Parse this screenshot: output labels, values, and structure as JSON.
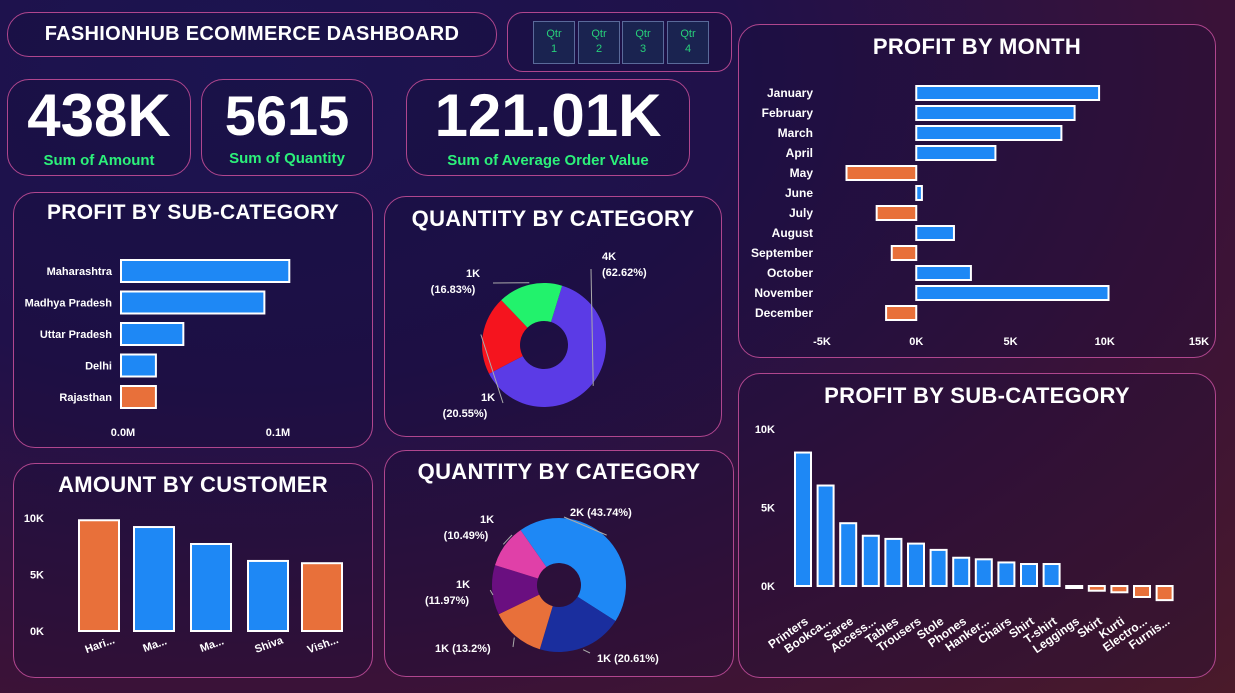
{
  "header": {
    "title": "FASHIONHUB ECOMMERCE DASHBOARD"
  },
  "quarter_slicer": {
    "buttons": [
      {
        "line1": "Qtr",
        "line2": "1"
      },
      {
        "line1": "Qtr",
        "line2": "2"
      },
      {
        "line1": "Qtr",
        "line2": "3"
      },
      {
        "line1": "Qtr",
        "line2": "4"
      }
    ]
  },
  "kpis": [
    {
      "value": "438K",
      "label": "Sum of Amount"
    },
    {
      "value": "5615",
      "label": "Sum of Quantity"
    },
    {
      "value": "121.01K",
      "label": "Sum of Average Order Value"
    }
  ],
  "colors": {
    "positive": "#1e88f5",
    "negative": "#e8703a",
    "green_label": "#2cf07a"
  },
  "chart_data": [
    {
      "id": "profit_by_state",
      "type": "bar",
      "orientation": "horizontal",
      "title": "PROFIT BY SUB-CATEGORY",
      "categories": [
        "Maharashtra",
        "Madhya Pradesh",
        "Uttar Pradesh",
        "Delhi",
        "Rajasthan"
      ],
      "values": [
        0.135,
        0.115,
        0.05,
        0.028,
        0.028
      ],
      "bar_colors": [
        "#1e88f5",
        "#1e88f5",
        "#1e88f5",
        "#1e88f5",
        "#e8703a"
      ],
      "ticks": [
        {
          "v": 0,
          "label": "0.0M"
        },
        {
          "v": 0.1,
          "label": "0.1M"
        }
      ],
      "xlim": [
        0,
        0.15
      ]
    },
    {
      "id": "quantity_by_category_1",
      "type": "pie",
      "donut": true,
      "title": "QUANTITY BY CATEGORY",
      "slices": [
        {
          "value": 62.62,
          "color": "#5b3be6",
          "label_top": "4K",
          "label_bottom": "(62.62%)"
        },
        {
          "value": 20.55,
          "color": "#f5141e",
          "label_top": "1K",
          "label_bottom": "(20.55%)"
        },
        {
          "value": 16.83,
          "color": "#22f26c",
          "label_top": "1K",
          "label_bottom": "(16.83%)"
        }
      ]
    },
    {
      "id": "quantity_by_category_2",
      "type": "pie",
      "donut": true,
      "title": "QUANTITY BY CATEGORY",
      "slices": [
        {
          "value": 43.74,
          "color": "#1e88f5",
          "label_top": "2K (43.74%)",
          "label_bottom": ""
        },
        {
          "value": 20.61,
          "color": "#1a2e9e",
          "label_top": "1K (20.61%)",
          "label_bottom": ""
        },
        {
          "value": 13.2,
          "color": "#e8703a",
          "label_top": "1K (13.2%)",
          "label_bottom": ""
        },
        {
          "value": 11.97,
          "color": "#6a0f80",
          "label_top": "1K",
          "label_bottom": "(11.97%)"
        },
        {
          "value": 10.49,
          "color": "#e040a8",
          "label_top": "1K",
          "label_bottom": "(10.49%)"
        }
      ]
    },
    {
      "id": "amount_by_customer",
      "type": "bar",
      "title": "AMOUNT BY CUSTOMER",
      "categories": [
        "Hari...",
        "Ma...",
        "Ma...",
        "Shiva",
        "Vish..."
      ],
      "values": [
        9800,
        9200,
        7700,
        6200,
        6000
      ],
      "bar_colors": [
        "#e8703a",
        "#1e88f5",
        "#1e88f5",
        "#1e88f5",
        "#e8703a"
      ],
      "ticks": [
        {
          "v": 0,
          "label": "0K"
        },
        {
          "v": 5000,
          "label": "5K"
        },
        {
          "v": 10000,
          "label": "10K"
        }
      ],
      "ylim": [
        0,
        10000
      ]
    },
    {
      "id": "profit_by_month",
      "type": "bar",
      "orientation": "horizontal",
      "title": "PROFIT BY MONTH",
      "categories": [
        "January",
        "February",
        "March",
        "April",
        "May",
        "June",
        "July",
        "August",
        "September",
        "October",
        "November",
        "December"
      ],
      "values": [
        9700,
        8400,
        7700,
        4200,
        -3700,
        300,
        -2100,
        2000,
        -1300,
        2900,
        10200,
        -1600
      ],
      "ticks": [
        {
          "v": -5000,
          "label": "-5K"
        },
        {
          "v": 0,
          "label": "0K"
        },
        {
          "v": 5000,
          "label": "5K"
        },
        {
          "v": 10000,
          "label": "10K"
        },
        {
          "v": 15000,
          "label": "15K"
        }
      ],
      "xlim": [
        -5000,
        15000
      ]
    },
    {
      "id": "profit_by_subcategory",
      "type": "bar",
      "title": "PROFIT BY SUB-CATEGORY",
      "categories": [
        "Printers",
        "Bookca...",
        "Saree",
        "Access...",
        "Tables",
        "Trousers",
        "Stole",
        "Phones",
        "Hanker...",
        "Chairs",
        "Shirt",
        "T-shirt",
        "Leggings",
        "Skirt",
        "Kurti",
        "Electro...",
        "Furnis..."
      ],
      "values": [
        8500,
        6400,
        4000,
        3200,
        3000,
        2700,
        2300,
        1800,
        1700,
        1500,
        1400,
        1400,
        -100,
        -300,
        -400,
        -700,
        -900
      ],
      "ticks": [
        {
          "v": 0,
          "label": "0K"
        },
        {
          "v": 5000,
          "label": "5K"
        },
        {
          "v": 10000,
          "label": "10K"
        }
      ],
      "ylim": [
        0,
        10000
      ]
    }
  ]
}
